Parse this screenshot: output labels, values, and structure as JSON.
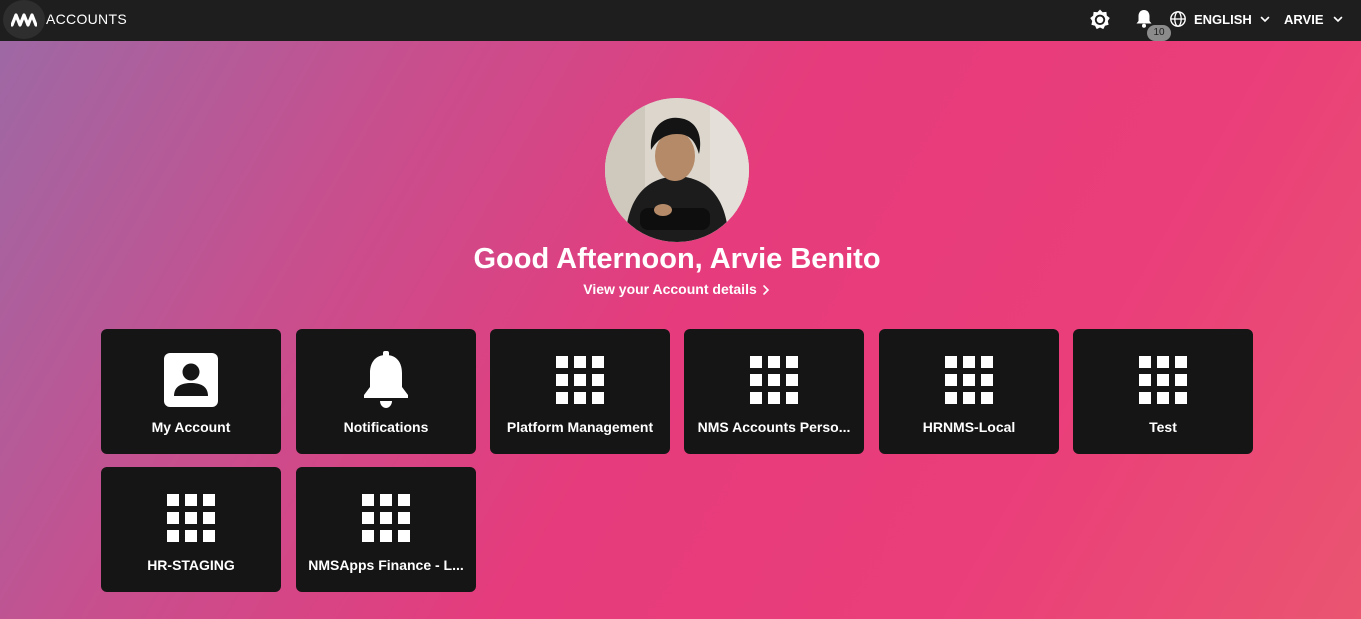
{
  "header": {
    "app_title": "ACCOUNTS",
    "notification_count": "10",
    "language_label": "ENGLISH",
    "user_label": "ARVIE"
  },
  "profile": {
    "greeting": "Good Afternoon, Arvie Benito",
    "account_link": "View your Account details"
  },
  "tiles": [
    {
      "label": "My Account",
      "icon": "person-icon"
    },
    {
      "label": "Notifications",
      "icon": "bell-icon"
    },
    {
      "label": "Platform Management",
      "icon": "grid-icon"
    },
    {
      "label": "NMS Accounts Perso...",
      "icon": "grid-icon"
    },
    {
      "label": "HRNMS-Local",
      "icon": "grid-icon"
    },
    {
      "label": "Test",
      "icon": "grid-icon"
    },
    {
      "label": "HR-STAGING",
      "icon": "grid-icon"
    },
    {
      "label": "NMSApps Finance - L...",
      "icon": "grid-icon"
    }
  ],
  "colors": {
    "topbar": "#1e1e1e",
    "tile": "#151515",
    "badge": "#8b8b8b"
  }
}
